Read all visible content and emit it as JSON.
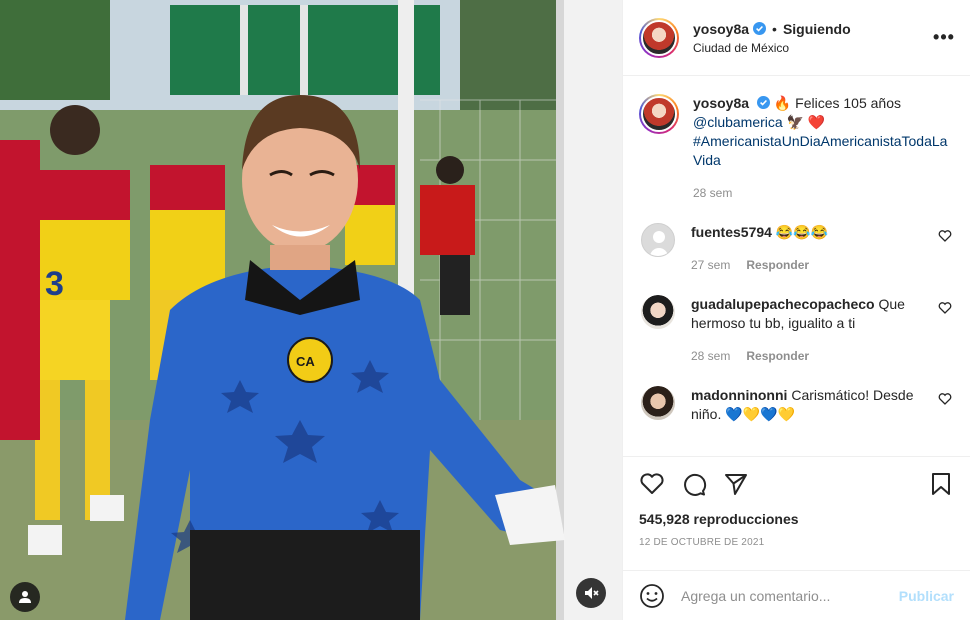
{
  "header": {
    "username": "yosoy8a",
    "separator": "•",
    "follow_status": "Siguiendo",
    "location": "Ciudad de México",
    "more_label": "•••"
  },
  "caption": {
    "username": "yosoy8a",
    "text_part1": "🔥 Felices 105 años",
    "mention": "@clubamerica",
    "text_part2": "🦅 ❤️",
    "hashtag": "#AmericanistaUnDiaAmericanistaTodaLaVida",
    "time": "28 sem"
  },
  "comments": [
    {
      "username": "fuentes5794",
      "text": "😂😂😂",
      "time": "27 sem",
      "reply": "Responder"
    },
    {
      "username": "guadalupepachecopacheco",
      "text": "Que hermoso tu bb, igualito a ti",
      "time": "28 sem",
      "reply": "Responder"
    },
    {
      "username": "madonninonni",
      "text": "Carismático! Desde niño. 💙💛💙💛",
      "time": "",
      "reply": ""
    }
  ],
  "stats": {
    "views": "545,928 reproducciones",
    "date": "12 DE OCTUBRE DE 2021"
  },
  "add_comment": {
    "placeholder": "Agrega un comentario...",
    "publish": "Publicar"
  },
  "icons": {
    "like": "heart-icon",
    "comment": "comment-icon",
    "share": "send-icon",
    "save": "bookmark-icon",
    "emoji": "smiley-icon",
    "tag": "user-tag-icon",
    "mute": "muted-speaker-icon",
    "verified": "verified-badge-icon"
  },
  "colors": {
    "link": "#00376b",
    "verified": "#3897f0",
    "muted_text": "#8e8e8e",
    "publish_disabled": "#b2dffc"
  }
}
